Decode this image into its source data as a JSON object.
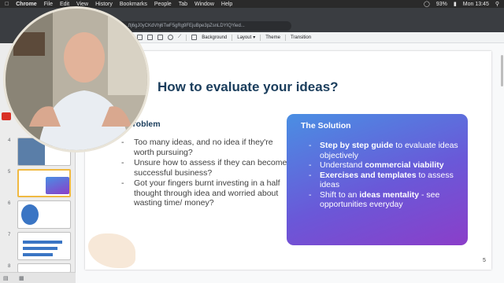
{
  "menubar": {
    "apple": "",
    "items": [
      "Chrome",
      "File",
      "Edit",
      "View",
      "History",
      "Bookmarks",
      "People",
      "Tab",
      "Window",
      "Help"
    ],
    "battery": "93%",
    "clock": "Mon 13:45"
  },
  "browser": {
    "url": "...ftj6gJ0yCKdVhj6TwF5gRg9FEjuBpe3pZsnLDYIQYied..."
  },
  "toolbar": {
    "background": "Background",
    "layout": "Layout",
    "theme": "Theme",
    "transition": "Transition"
  },
  "thumbnails": {
    "numbers": [
      "4",
      "5",
      "6",
      "7",
      "8"
    ]
  },
  "slide": {
    "title": "How to evaluate your ideas?",
    "problem_title": "The Problem",
    "problem_bullets": [
      "Too many ideas, and no idea if they're worth pursuing?",
      "Unsure how to assess if they can become a successful business?",
      "Got your fingers burnt investing in a half thought through idea and worried about wasting time/ money?"
    ],
    "solution_title": "The Solution",
    "solution_b1_bold": "Step by step guide",
    "solution_b1_rest": " to evaluate ideas objectively",
    "solution_b2_pre": "Understand ",
    "solution_b2_bold": "commercial viability",
    "solution_b3_bold": "Exercises and templates",
    "solution_b3_rest": " to assess ideas",
    "solution_b4_pre": "Shift to an ",
    "solution_b4_bold": "ideas mentality",
    "solution_b4_rest": " - see opportunities everyday",
    "page_number": "5"
  },
  "colors": {
    "title": "#1a3d5c",
    "solution_gradient_start": "#4a8fe3",
    "solution_gradient_end": "#8b3ec9",
    "selected_thumb": "#f0b942"
  }
}
